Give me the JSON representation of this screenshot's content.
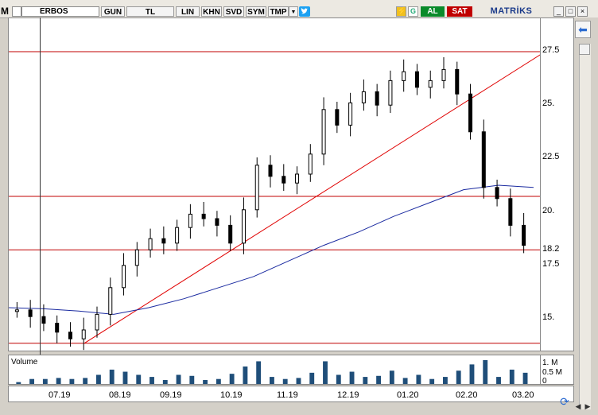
{
  "toolbar": {
    "app_letter": "M",
    "symbol": "ERBOS",
    "buttons": [
      "GUN",
      "TL",
      "LIN",
      "KHN",
      "SVD",
      "SYM",
      "TMP"
    ],
    "dropdown_glyph": "▼",
    "alert_glyph": "⚡",
    "g_label": "G",
    "buy_label": "AL",
    "sell_label": "SAT",
    "brand": "MATRİKS",
    "window_buttons": [
      "_",
      "□",
      "×"
    ],
    "colors": {
      "buy": "#0a8a2a",
      "sell": "#c00000",
      "brand": "#1a3a8a",
      "twitter": "#1da1f2"
    }
  },
  "side": {
    "arrow_glyph": "⬅",
    "sync_glyph": "⟳",
    "nav_left": "◀",
    "nav_right": "▶"
  },
  "chart_data": {
    "type": "candlestick",
    "symbol": "ERBOS",
    "y_ticks": [
      "27.5",
      "25.",
      "22.5",
      "20.",
      "18.2",
      "17.5",
      "15."
    ],
    "ylim": [
      13.6,
      28.6
    ],
    "x_ticks": [
      "07.19",
      "08.19",
      "09.19",
      "10.19",
      "11.19",
      "12.19",
      "01.20",
      "02.20",
      "03.20"
    ],
    "horizontal_lines": [
      27.1,
      20.6,
      18.2,
      14.0
    ],
    "trendline": {
      "from": [
        0,
        14.0
      ],
      "to": [
        1,
        27.0
      ]
    },
    "moving_average": [
      15.6,
      15.55,
      15.45,
      15.3,
      15.6,
      16.0,
      16.5,
      17.0,
      17.7,
      18.4,
      19.0,
      19.7,
      20.3,
      20.9,
      21.1,
      21.0
    ],
    "close": [
      15.5,
      15.2,
      14.9,
      14.5,
      14.2,
      14.6,
      15.3,
      16.5,
      17.5,
      18.2,
      18.7,
      18.5,
      19.2,
      19.8,
      19.6,
      19.3,
      18.5,
      20.0,
      22.0,
      21.5,
      21.2,
      21.6,
      22.5,
      24.5,
      23.8,
      24.8,
      25.3,
      24.7,
      25.8,
      26.2,
      25.5,
      25.8,
      26.3,
      25.2,
      23.5,
      21.0,
      20.5,
      19.3,
      18.4
    ],
    "volume": {
      "ticks": [
        "1. M",
        "0.5 M",
        "0"
      ],
      "peak_m": 1.1,
      "label": "Volume"
    }
  }
}
